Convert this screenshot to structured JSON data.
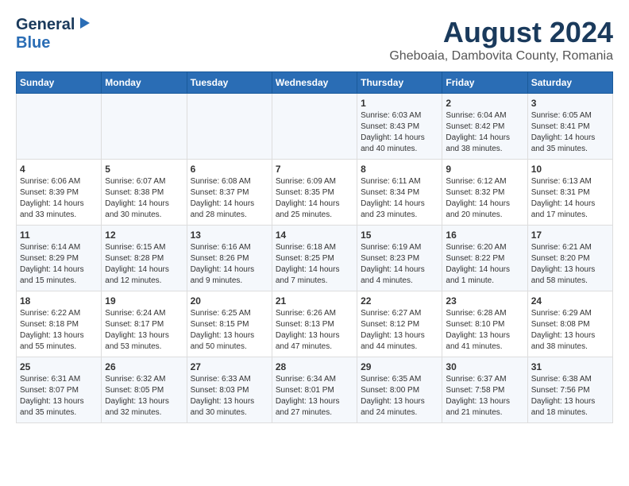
{
  "header": {
    "title": "August 2024",
    "subtitle": "Gheboaia, Dambovita County, Romania",
    "logo_general": "General",
    "logo_blue": "Blue"
  },
  "days_of_week": [
    "Sunday",
    "Monday",
    "Tuesday",
    "Wednesday",
    "Thursday",
    "Friday",
    "Saturday"
  ],
  "weeks": [
    [
      {
        "day": "",
        "info": ""
      },
      {
        "day": "",
        "info": ""
      },
      {
        "day": "",
        "info": ""
      },
      {
        "day": "",
        "info": ""
      },
      {
        "day": "1",
        "info": "Sunrise: 6:03 AM\nSunset: 8:43 PM\nDaylight: 14 hours\nand 40 minutes."
      },
      {
        "day": "2",
        "info": "Sunrise: 6:04 AM\nSunset: 8:42 PM\nDaylight: 14 hours\nand 38 minutes."
      },
      {
        "day": "3",
        "info": "Sunrise: 6:05 AM\nSunset: 8:41 PM\nDaylight: 14 hours\nand 35 minutes."
      }
    ],
    [
      {
        "day": "4",
        "info": "Sunrise: 6:06 AM\nSunset: 8:39 PM\nDaylight: 14 hours\nand 33 minutes."
      },
      {
        "day": "5",
        "info": "Sunrise: 6:07 AM\nSunset: 8:38 PM\nDaylight: 14 hours\nand 30 minutes."
      },
      {
        "day": "6",
        "info": "Sunrise: 6:08 AM\nSunset: 8:37 PM\nDaylight: 14 hours\nand 28 minutes."
      },
      {
        "day": "7",
        "info": "Sunrise: 6:09 AM\nSunset: 8:35 PM\nDaylight: 14 hours\nand 25 minutes."
      },
      {
        "day": "8",
        "info": "Sunrise: 6:11 AM\nSunset: 8:34 PM\nDaylight: 14 hours\nand 23 minutes."
      },
      {
        "day": "9",
        "info": "Sunrise: 6:12 AM\nSunset: 8:32 PM\nDaylight: 14 hours\nand 20 minutes."
      },
      {
        "day": "10",
        "info": "Sunrise: 6:13 AM\nSunset: 8:31 PM\nDaylight: 14 hours\nand 17 minutes."
      }
    ],
    [
      {
        "day": "11",
        "info": "Sunrise: 6:14 AM\nSunset: 8:29 PM\nDaylight: 14 hours\nand 15 minutes."
      },
      {
        "day": "12",
        "info": "Sunrise: 6:15 AM\nSunset: 8:28 PM\nDaylight: 14 hours\nand 12 minutes."
      },
      {
        "day": "13",
        "info": "Sunrise: 6:16 AM\nSunset: 8:26 PM\nDaylight: 14 hours\nand 9 minutes."
      },
      {
        "day": "14",
        "info": "Sunrise: 6:18 AM\nSunset: 8:25 PM\nDaylight: 14 hours\nand 7 minutes."
      },
      {
        "day": "15",
        "info": "Sunrise: 6:19 AM\nSunset: 8:23 PM\nDaylight: 14 hours\nand 4 minutes."
      },
      {
        "day": "16",
        "info": "Sunrise: 6:20 AM\nSunset: 8:22 PM\nDaylight: 14 hours\nand 1 minute."
      },
      {
        "day": "17",
        "info": "Sunrise: 6:21 AM\nSunset: 8:20 PM\nDaylight: 13 hours\nand 58 minutes."
      }
    ],
    [
      {
        "day": "18",
        "info": "Sunrise: 6:22 AM\nSunset: 8:18 PM\nDaylight: 13 hours\nand 55 minutes."
      },
      {
        "day": "19",
        "info": "Sunrise: 6:24 AM\nSunset: 8:17 PM\nDaylight: 13 hours\nand 53 minutes."
      },
      {
        "day": "20",
        "info": "Sunrise: 6:25 AM\nSunset: 8:15 PM\nDaylight: 13 hours\nand 50 minutes."
      },
      {
        "day": "21",
        "info": "Sunrise: 6:26 AM\nSunset: 8:13 PM\nDaylight: 13 hours\nand 47 minutes."
      },
      {
        "day": "22",
        "info": "Sunrise: 6:27 AM\nSunset: 8:12 PM\nDaylight: 13 hours\nand 44 minutes."
      },
      {
        "day": "23",
        "info": "Sunrise: 6:28 AM\nSunset: 8:10 PM\nDaylight: 13 hours\nand 41 minutes."
      },
      {
        "day": "24",
        "info": "Sunrise: 6:29 AM\nSunset: 8:08 PM\nDaylight: 13 hours\nand 38 minutes."
      }
    ],
    [
      {
        "day": "25",
        "info": "Sunrise: 6:31 AM\nSunset: 8:07 PM\nDaylight: 13 hours\nand 35 minutes."
      },
      {
        "day": "26",
        "info": "Sunrise: 6:32 AM\nSunset: 8:05 PM\nDaylight: 13 hours\nand 32 minutes."
      },
      {
        "day": "27",
        "info": "Sunrise: 6:33 AM\nSunset: 8:03 PM\nDaylight: 13 hours\nand 30 minutes."
      },
      {
        "day": "28",
        "info": "Sunrise: 6:34 AM\nSunset: 8:01 PM\nDaylight: 13 hours\nand 27 minutes."
      },
      {
        "day": "29",
        "info": "Sunrise: 6:35 AM\nSunset: 8:00 PM\nDaylight: 13 hours\nand 24 minutes."
      },
      {
        "day": "30",
        "info": "Sunrise: 6:37 AM\nSunset: 7:58 PM\nDaylight: 13 hours\nand 21 minutes."
      },
      {
        "day": "31",
        "info": "Sunrise: 6:38 AM\nSunset: 7:56 PM\nDaylight: 13 hours\nand 18 minutes."
      }
    ]
  ]
}
